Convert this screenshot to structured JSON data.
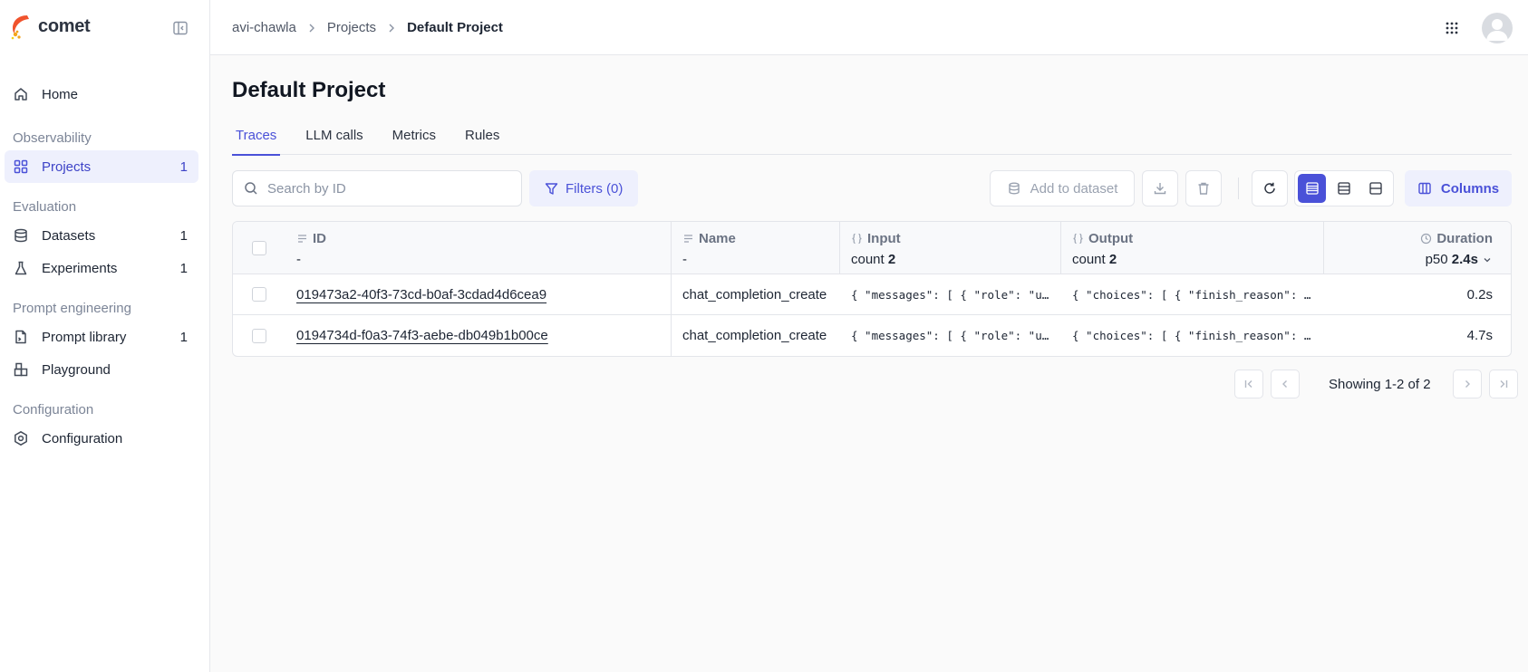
{
  "brand": {
    "name": "comet",
    "logo_colors": [
      "#f0532d",
      "#f4a51c",
      "#f0d21c"
    ]
  },
  "sidebar": {
    "home": {
      "label": "Home",
      "icon": "home-icon"
    },
    "sections": [
      {
        "title": "Observability",
        "items": [
          {
            "label": "Projects",
            "count": "1",
            "icon": "grid-icon",
            "active": true
          }
        ]
      },
      {
        "title": "Evaluation",
        "items": [
          {
            "label": "Datasets",
            "count": "1",
            "icon": "database-icon"
          },
          {
            "label": "Experiments",
            "count": "1",
            "icon": "flask-icon"
          }
        ]
      },
      {
        "title": "Prompt engineering",
        "items": [
          {
            "label": "Prompt library",
            "count": "1",
            "icon": "file-icon"
          },
          {
            "label": "Playground",
            "count": "",
            "icon": "blocks-icon"
          }
        ]
      },
      {
        "title": "Configuration",
        "items": [
          {
            "label": "Configuration",
            "count": "",
            "icon": "settings-icon"
          }
        ]
      }
    ]
  },
  "breadcrumb": {
    "workspace": "avi-chawla",
    "projects": "Projects",
    "current": "Default Project"
  },
  "page": {
    "title": "Default Project",
    "tabs": [
      {
        "label": "Traces",
        "active": true
      },
      {
        "label": "LLM calls"
      },
      {
        "label": "Metrics"
      },
      {
        "label": "Rules"
      }
    ]
  },
  "toolbar": {
    "search_placeholder": "Search by ID",
    "filters_label": "Filters (0)",
    "add_to_dataset_label": "Add to dataset",
    "columns_label": "Columns",
    "accent_color": "#4a51d8"
  },
  "table": {
    "columns": {
      "id": {
        "label": "ID",
        "stat": "-"
      },
      "name": {
        "label": "Name",
        "stat": "-"
      },
      "input": {
        "label": "Input",
        "stat_prefix": "count",
        "stat_value": "2"
      },
      "output": {
        "label": "Output",
        "stat_prefix": "count",
        "stat_value": "2"
      },
      "duration": {
        "label": "Duration",
        "stat_prefix": "p50",
        "stat_value": "2.4s"
      }
    },
    "rows": [
      {
        "id": "019473a2-40f3-73cd-b0af-3cdad4d6cea9",
        "name": "chat_completion_create",
        "input": "{ \"messages\": [ { \"role\": \"user\", \"content\": \"",
        "output": "{ \"choices\": [ { \"finish_reason\": \"stop\"",
        "duration": "0.2s"
      },
      {
        "id": "0194734d-f0a3-74f3-aebe-db049b1b00ce",
        "name": "chat_completion_create",
        "input": "{ \"messages\": [ { \"role\": \"user\", \"content\": \"",
        "output": "{ \"choices\": [ { \"finish_reason\": \"stop\"",
        "duration": "4.7s"
      }
    ]
  },
  "pagination": {
    "label": "Showing 1-2 of 2"
  }
}
